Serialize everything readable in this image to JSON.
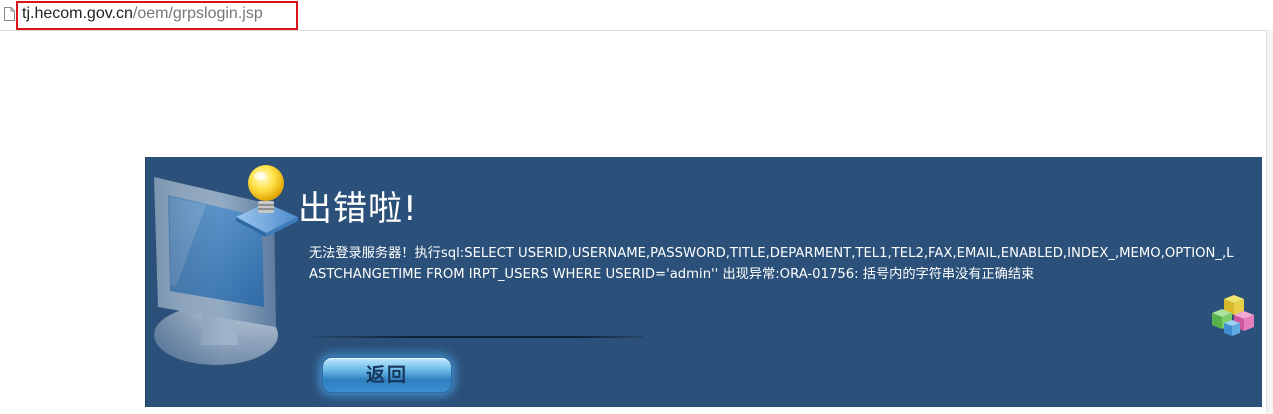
{
  "address_bar": {
    "url_host": "tj.hecom.gov.cn",
    "url_path": "/oem/grpslogin.jsp",
    "page_icon": "page-icon",
    "highlight_color": "#d9141b"
  },
  "error_panel": {
    "background_color": "#2b5079",
    "title": "出错啦!",
    "message": "无法登录服务器！执行sql:SELECT USERID,USERNAME,PASSWORD,TITLE,DEPARMENT,TEL1,TEL2,FAX,EMAIL,ENABLED,INDEX_,MEMO,OPTION_,LASTCHANGETIME FROM IRPT_USERS WHERE USERID='admin'' 出现异常:ORA-01756: 括号内的字符串没有正确结束",
    "back_button_label": "返回",
    "icons": [
      "monitor-icon",
      "lightbulb-icon",
      "cubes-icon"
    ]
  }
}
